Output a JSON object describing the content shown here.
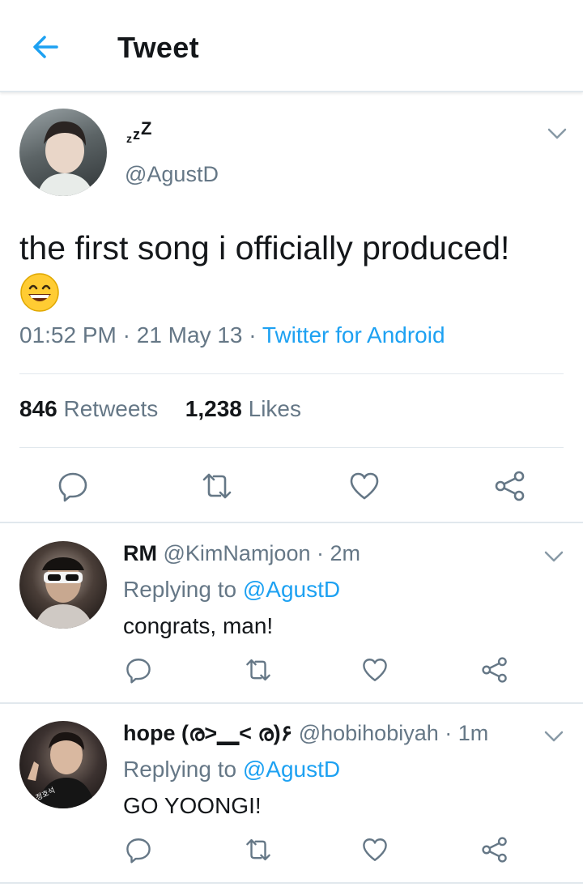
{
  "header": {
    "title": "Tweet"
  },
  "tweet": {
    "display_name": "zzZ",
    "handle": "@AgustD",
    "text": "the first song i officially produced!",
    "time": "01:52 PM",
    "date": "21 May 13",
    "source": "Twitter for Android",
    "retweets_count": "846",
    "retweets_label": "Retweets",
    "likes_count": "1,238",
    "likes_label": "Likes",
    "emoji": "grinning-face-emoji"
  },
  "replies": [
    {
      "name": "RM",
      "handle": "@KimNamjoon",
      "time": "2m",
      "replying_prefix": "Replying to",
      "replying_to": "@AgustD",
      "text": "congrats, man!"
    },
    {
      "name": "hope (ര>▁< ര)۶",
      "handle": "@hobihobiyah",
      "time": "1m",
      "replying_prefix": "Replying to",
      "replying_to": "@AgustD",
      "text": "GO YOONGI!"
    }
  ],
  "colors": {
    "accent": "#1da1f2",
    "secondary_text": "#657786",
    "primary_text": "#14171a",
    "divider": "#e1e8ed"
  },
  "icons": [
    "back-arrow-icon",
    "chevron-down-icon",
    "reply-icon",
    "retweet-icon",
    "like-icon",
    "share-icon"
  ]
}
